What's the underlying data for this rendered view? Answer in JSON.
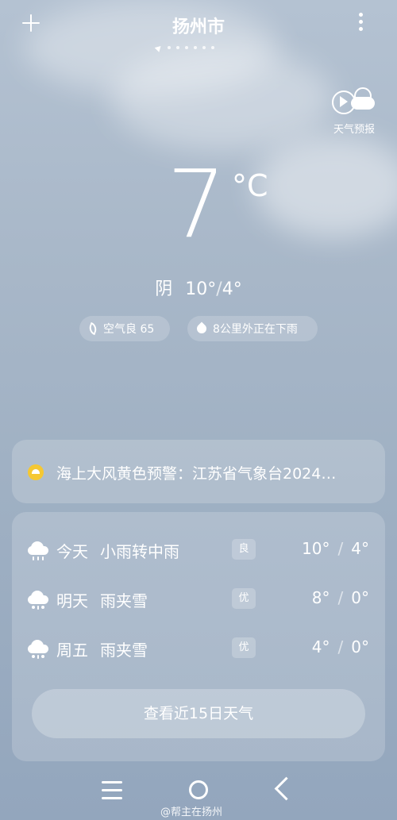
{
  "header": {
    "city": "扬州市",
    "page_count": 7
  },
  "forecast_video": {
    "label": "天气预报",
    "icon": "play-weather-icon"
  },
  "current": {
    "temperature": "7",
    "unit": "°C",
    "condition": "阴",
    "high": "10°",
    "low": "4°",
    "range_sep": "/"
  },
  "pills": {
    "air_quality": "空气良 65",
    "rain": "8公里外正在下雨"
  },
  "alert": {
    "text": "海上大风黄色预警：江苏省气象台2024…",
    "color": "#f5c833"
  },
  "forecast": [
    {
      "day": "今天",
      "desc": "小雨转中雨",
      "aq": "良",
      "high": "10°",
      "low": "4°",
      "icon": "rain-cloud-icon"
    },
    {
      "day": "明天",
      "desc": "雨夹雪",
      "aq": "优",
      "high": "8°",
      "low": "0°",
      "icon": "sleet-cloud-icon"
    },
    {
      "day": "周五",
      "desc": "雨夹雪",
      "aq": "优",
      "high": "4°",
      "low": "0°",
      "icon": "sleet-cloud-icon"
    }
  ],
  "fifteen_day_button": "查看近15日天气",
  "watermark": "@帮主在扬州"
}
